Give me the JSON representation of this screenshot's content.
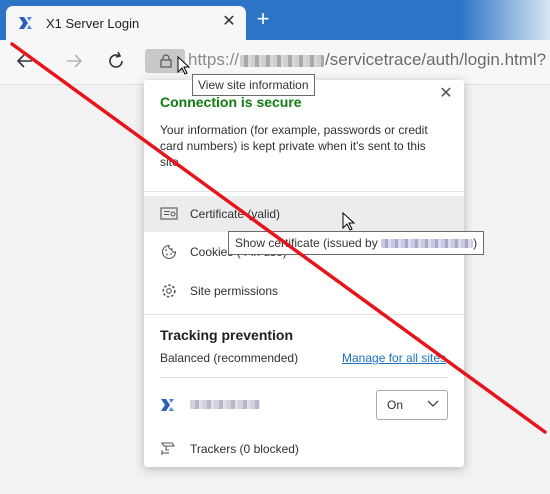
{
  "tab": {
    "title": "X1 Server Login",
    "close": "✕",
    "new": "+"
  },
  "toolbar": {
    "url_prefix": "https://",
    "url_suffix": "/servicetrace/auth/login.html?"
  },
  "tooltip_site_info": "View site information",
  "panel": {
    "close": "✕",
    "secure_title": "Connection is secure",
    "secure_desc": "Your information (for example, passwords or credit card numbers) is kept private when it's sent to this site.",
    "certificate_label": "Certificate (valid)",
    "cookies_label": "Cookies (4 in use)",
    "permissions_label": "Site permissions",
    "tracking_title": "Tracking prevention",
    "tracking_level": "Balanced (recommended)",
    "manage_link": "Manage for all sites",
    "site_toggle_value": "On",
    "trackers_label": "Trackers (0 blocked)"
  },
  "tooltip_certificate": {
    "prefix": "Show certificate (issued by ",
    "suffix": ")"
  },
  "colors": {
    "accent": "#2b74c6",
    "secure_green": "#107c10",
    "link_blue": "#1a6fc2",
    "overlay_red": "#e8141b"
  }
}
